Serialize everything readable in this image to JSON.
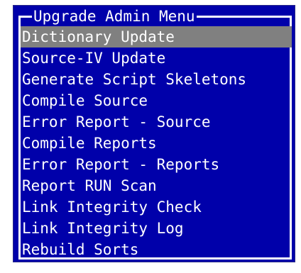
{
  "menu": {
    "title": "Upgrade Admin Menu",
    "selected_index": 0,
    "items": [
      {
        "label": "Dictionary Update"
      },
      {
        "label": "Source-IV Update"
      },
      {
        "label": "Generate Script Skeletons"
      },
      {
        "label": "Compile Source"
      },
      {
        "label": "Error Report - Source"
      },
      {
        "label": "Compile Reports"
      },
      {
        "label": "Error Report - Reports"
      },
      {
        "label": "Report RUN Scan"
      },
      {
        "label": "Link Integrity Check"
      },
      {
        "label": "Link Integrity Log"
      },
      {
        "label": "Rebuild Sorts"
      }
    ]
  },
  "colors": {
    "background": "#0000aa",
    "foreground": "#ffffff",
    "highlight": "#808080"
  }
}
